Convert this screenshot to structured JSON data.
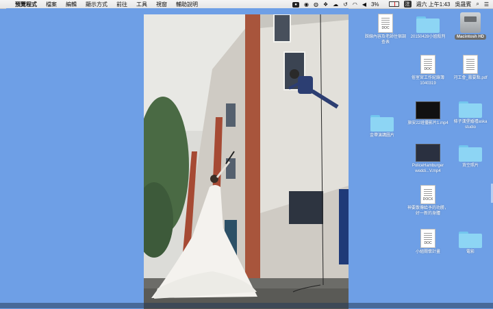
{
  "menubar": {
    "app": "預覽程式",
    "items": [
      "檔案",
      "編輯",
      "顯示方式",
      "前往",
      "工具",
      "視窗",
      "輔助說明"
    ],
    "battery_percent": "3%",
    "battery_level": 0.03,
    "input_method": "注",
    "clock": "週六 上午1:43",
    "user": "吳晟賓"
  },
  "desktop": {
    "items": [
      {
        "name": "踩線內容及老師住宿調查表",
        "type": "doc",
        "tag": "DOC"
      },
      {
        "name": "20150428小姐殺判",
        "type": "folder"
      },
      {
        "name": "Macintosh HD",
        "type": "drive"
      },
      {
        "name": "俗室宮工作紀錄簿1040319",
        "type": "doc",
        "tag": "DOC"
      },
      {
        "name": "河工會_霧要點.pdf",
        "type": "pdf"
      },
      {
        "name": "金帶演講圖片",
        "type": "folder"
      },
      {
        "name": "旗安22班優影片1.mp4",
        "type": "video"
      },
      {
        "name": "條子漢堡婚禮aska studio",
        "type": "folder"
      },
      {
        "name": "PoliceHamburger weddi...V.mp4",
        "type": "video"
      },
      {
        "name": "貨空照片",
        "type": "folder"
      },
      {
        "name": "神要散傳給予的功勝，好一新的身體",
        "type": "doc",
        "tag": "DOCX"
      },
      {
        "name": "小組關懷計畫",
        "type": "doc",
        "tag": "DOC"
      },
      {
        "name": "電影",
        "type": "folder"
      }
    ]
  }
}
